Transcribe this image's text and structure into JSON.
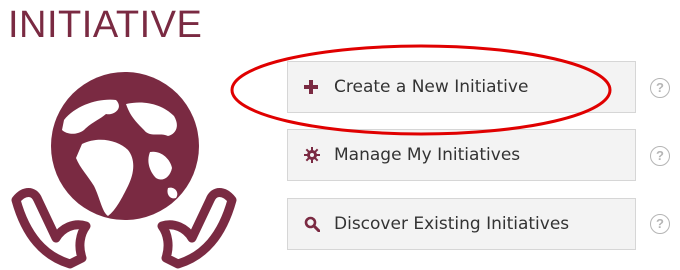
{
  "header": {
    "title": "INITIATIVE"
  },
  "logo": {
    "icon": "globe-in-hands-icon",
    "color": "#7a2a42"
  },
  "actions": [
    {
      "label": "Create a New Initiative",
      "icon": "plus-icon",
      "help": "?"
    },
    {
      "label": "Manage My Initiatives",
      "icon": "gear-icon",
      "help": "?"
    },
    {
      "label": "Discover Existing Initiatives",
      "icon": "search-icon",
      "help": "?"
    }
  ],
  "highlight": {
    "target": "Create a New Initiative",
    "color": "#e00000"
  }
}
